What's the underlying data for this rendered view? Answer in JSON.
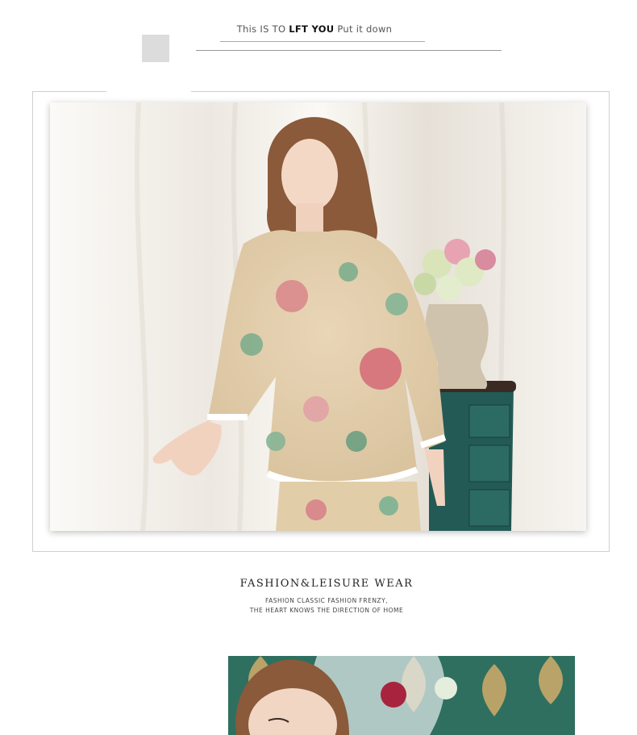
{
  "header": {
    "text_before": "This IS TO ",
    "text_emphasis": "LFT YOU",
    "text_after": " Put it down"
  },
  "section": {
    "title": "FASHION&LEISURE WEAR",
    "subtitle_line1": "FASHION CLASSIC FASHION FRENZY,",
    "subtitle_line2": "THE HEART KNOWS THE DIRECTION OF HOME"
  }
}
